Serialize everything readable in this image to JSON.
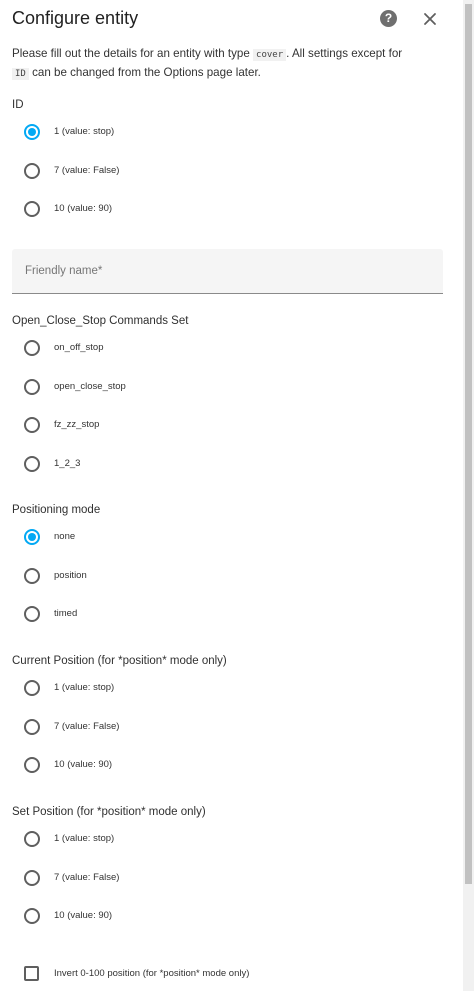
{
  "dialog": {
    "title": "Configure entity",
    "description_pre": "Please fill out the details for an entity with type",
    "entity_type": "cover",
    "description_mid": ". All settings except for",
    "id_code": "ID",
    "description_post": "can be changed from the Options page later."
  },
  "id_field": {
    "label": "ID",
    "options": [
      "1 (value: stop)",
      "7 (value: False)",
      "10 (value: 90)"
    ],
    "selected": 0
  },
  "friendly_name": {
    "placeholder": "Friendly name*",
    "value": ""
  },
  "commands_set": {
    "label": "Open_Close_Stop Commands Set",
    "options": [
      "on_off_stop",
      "open_close_stop",
      "fz_zz_stop",
      "1_2_3"
    ],
    "selected": null
  },
  "positioning_mode": {
    "label": "Positioning mode",
    "options": [
      "none",
      "position",
      "timed"
    ],
    "selected": 0
  },
  "current_position": {
    "label": "Current Position (for *position* mode only)",
    "options": [
      "1 (value: stop)",
      "7 (value: False)",
      "10 (value: 90)"
    ],
    "selected": null
  },
  "set_position": {
    "label": "Set Position (for *position* mode only)",
    "options": [
      "1 (value: stop)",
      "7 (value: False)",
      "10 (value: 90)"
    ],
    "selected": null
  },
  "invert": {
    "label": "Invert 0-100 position (for *position* mode only)",
    "checked": false
  },
  "colors": {
    "accent": "#03a9f4",
    "text": "#212121",
    "field_bg": "#f5f5f5"
  },
  "icons": {
    "help": "help-circle-icon",
    "close": "close-icon"
  }
}
